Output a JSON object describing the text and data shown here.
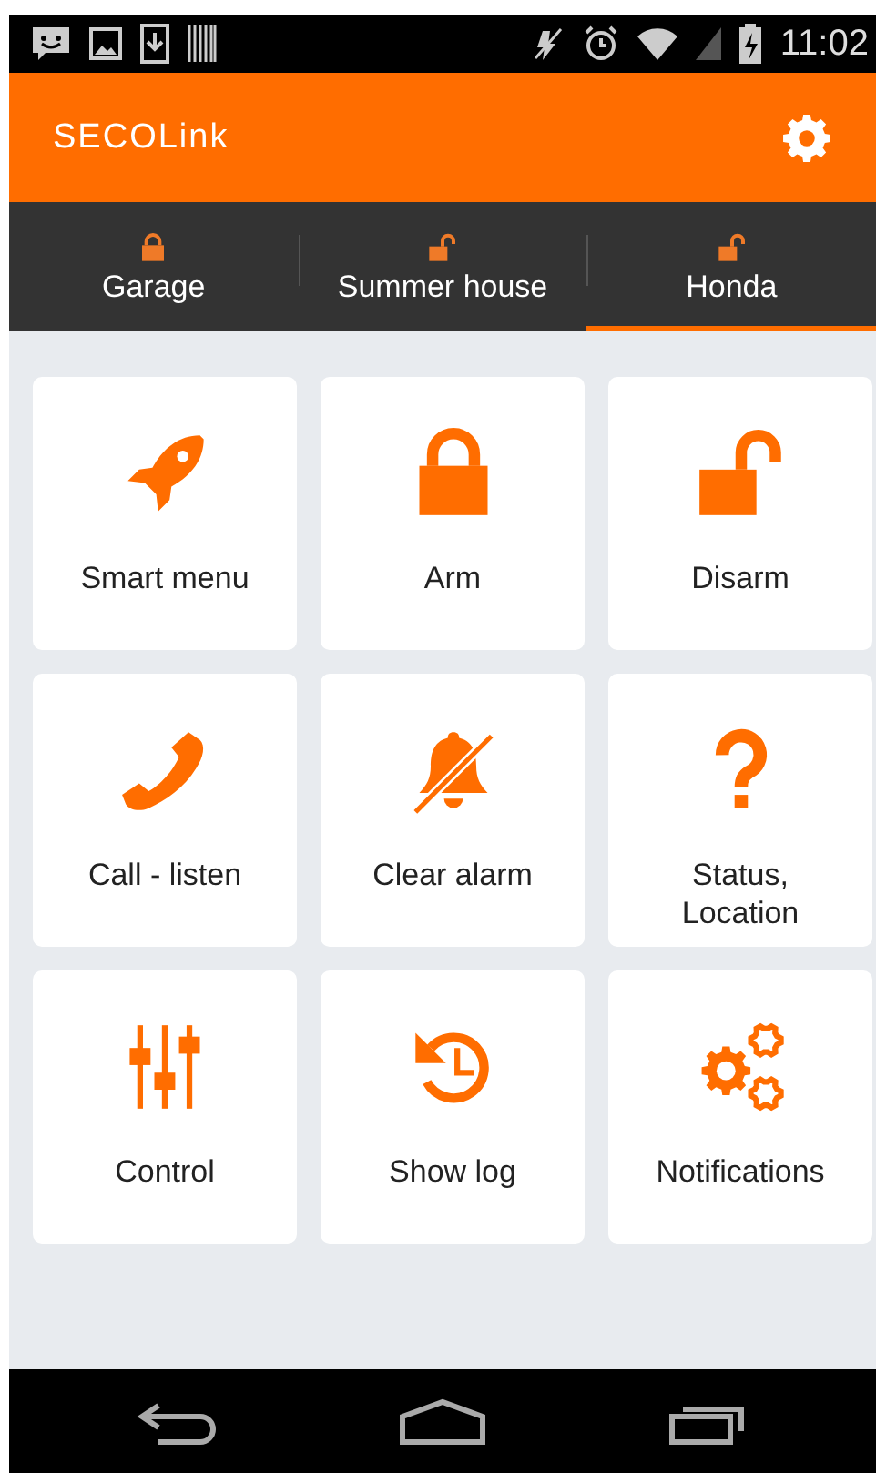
{
  "status_bar": {
    "time": "11:02"
  },
  "header": {
    "logo": "SECOLink"
  },
  "tabs": [
    {
      "label": "Garage",
      "locked": true,
      "selected": false
    },
    {
      "label": "Summer house",
      "locked": false,
      "selected": false
    },
    {
      "label": "Honda",
      "locked": false,
      "selected": true
    }
  ],
  "tiles": [
    {
      "label": "Smart menu"
    },
    {
      "label": "Arm"
    },
    {
      "label": "Disarm"
    },
    {
      "label": "Call - listen"
    },
    {
      "label": "Clear alarm"
    },
    {
      "label": "Status, Location"
    },
    {
      "label": "Control"
    },
    {
      "label": "Show log"
    },
    {
      "label": "Notifications"
    }
  ]
}
